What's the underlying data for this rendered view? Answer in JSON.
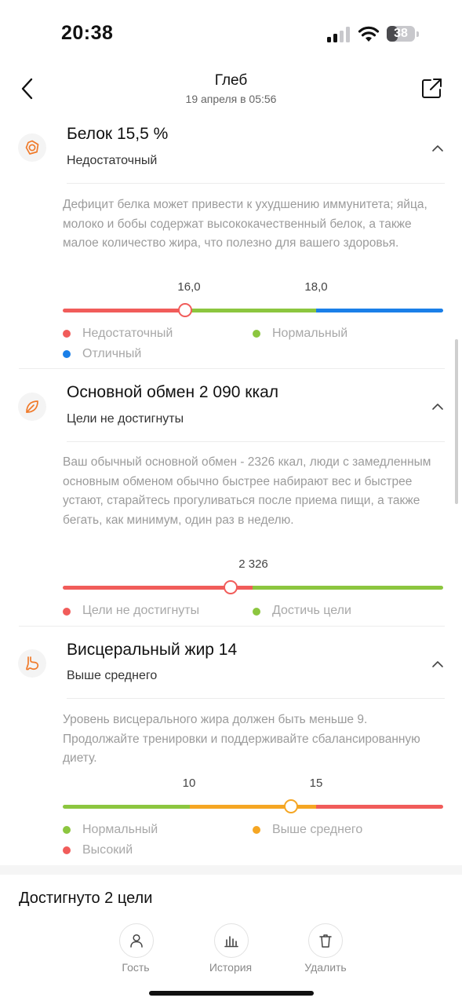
{
  "status_bar": {
    "time": "20:38",
    "battery": "38",
    "battery_level": 0.38
  },
  "header": {
    "title": "Глеб",
    "subtitle": "19 апреля в 05:56"
  },
  "sections": [
    {
      "icon": "protein-icon",
      "title": "Белок 15,5 %",
      "status": "Недостаточный",
      "description": "Дефицит белка может привести к ухудшению иммунитета; яйца, молоко и бобы содержат высококачественный белок, а также малое количество жира, что полезно для вашего здоровья.",
      "ticks": [
        "16,0",
        "18,0"
      ],
      "value": 15.5,
      "legend": [
        {
          "label": "Недостаточный",
          "color": "#f15c5a"
        },
        {
          "label": "Нормальный",
          "color": "#8cc63f"
        },
        {
          "label": "Отличный",
          "color": "#1a7fe8"
        }
      ]
    },
    {
      "icon": "leaf-icon",
      "title": "Основной обмен 2 090 ккал",
      "status": "Цели не достигнуты",
      "description": "Ваш обычный основной обмен - 2326 ккал, люди с замедленным основным обменом обычно быстрее набирают вес и быстрее устают, старайтесь прогуливаться после приема пищи, а также бегать, как минимум, один раз в неделю.",
      "ticks": [
        "2 326"
      ],
      "value": 2090,
      "legend": [
        {
          "label": "Цели не достигнуты",
          "color": "#f15c5a"
        },
        {
          "label": "Достичь цели",
          "color": "#8cc63f"
        }
      ]
    },
    {
      "icon": "stomach-icon",
      "title": "Висцеральный жир 14",
      "status": "Выше среднего",
      "description": "Уровень висцерального жира должен быть меньше 9. Продолжайте тренировки и поддерживайте сбалансированную диету.",
      "ticks": [
        "10",
        "15"
      ],
      "value": 14,
      "legend": [
        {
          "label": "Нормальный",
          "color": "#8cc63f"
        },
        {
          "label": "Выше среднего",
          "color": "#f5a623"
        },
        {
          "label": "Высокий",
          "color": "#f15c5a"
        }
      ]
    }
  ],
  "achieved": "Достигнуто 2 цели",
  "bottom_tabs": [
    {
      "icon": "user-icon",
      "label": "Гость"
    },
    {
      "icon": "chart-icon",
      "label": "История"
    },
    {
      "icon": "trash-icon",
      "label": "Удалить"
    }
  ],
  "colors": {
    "accent": "#f07a2a",
    "red": "#f15c5a",
    "green": "#8cc63f",
    "blue": "#1a7fe8",
    "orange": "#f5a623"
  }
}
